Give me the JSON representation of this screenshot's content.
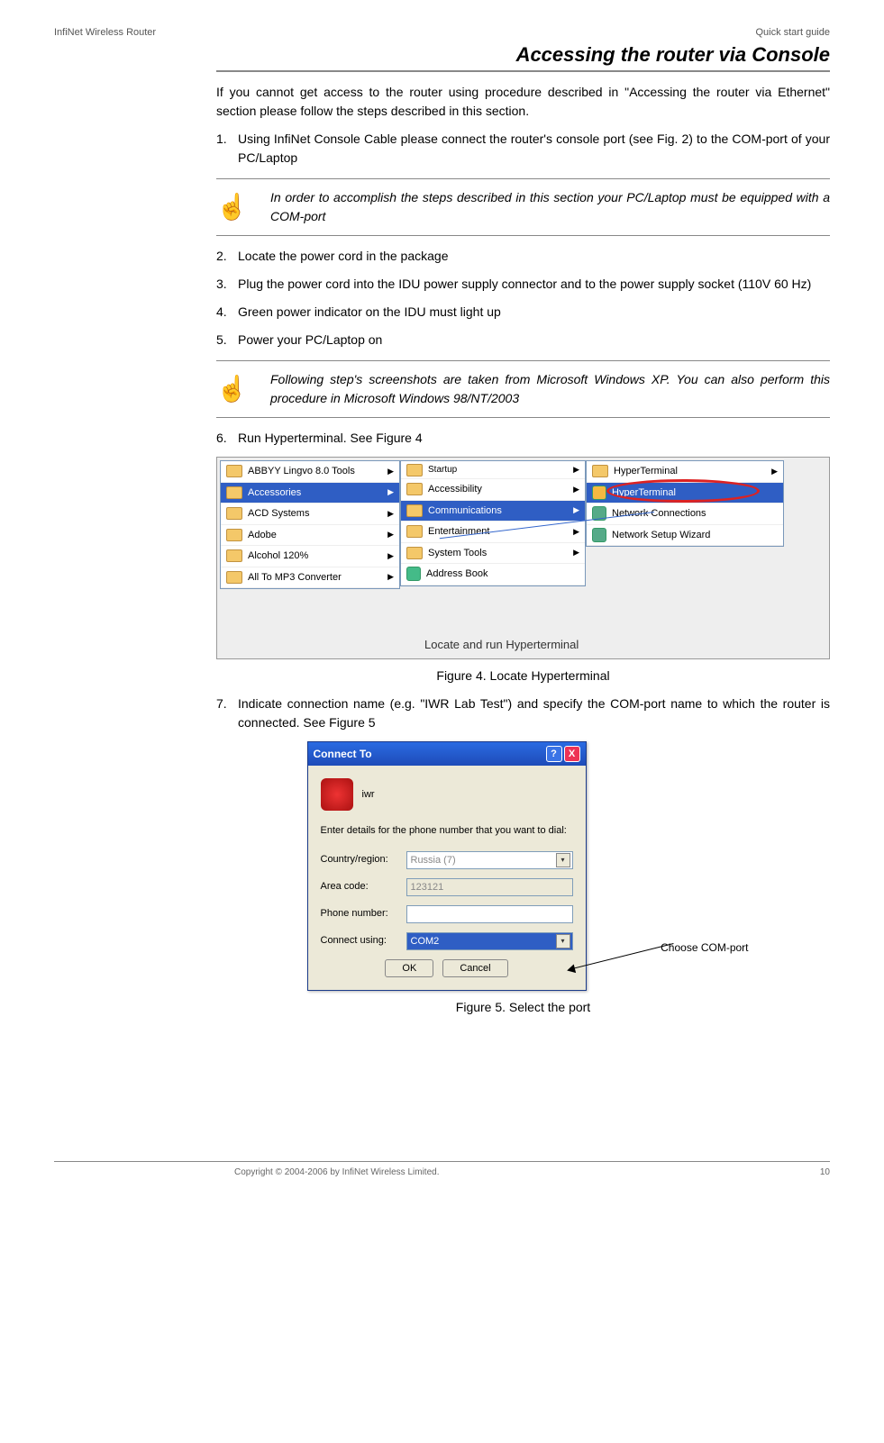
{
  "header": {
    "left": "InfiNet Wireless Router",
    "right": "Quick start guide"
  },
  "title": "Accessing the router via Console",
  "intro": "If you cannot get access to the router using procedure described in \"Accessing the router via Ethernet\" section please follow the steps described in this section.",
  "steps": {
    "s1": {
      "num": "1.",
      "text": "Using InfiNet Console Cable please connect the router's console port (see Fig. 2) to the COM-port of your PC/Laptop"
    },
    "s2": {
      "num": "2.",
      "text": "Locate the power cord in the package"
    },
    "s3": {
      "num": "3.",
      "text": "Plug the power cord into the IDU power supply connector and to the power supply socket (110V 60 Hz)"
    },
    "s4": {
      "num": "4.",
      "text": "Green power indicator on the IDU must light up"
    },
    "s5": {
      "num": "5.",
      "text": "Power your PC/Laptop on"
    },
    "s6": {
      "num": "6.",
      "text": "Run Hyperterminal. See Figure 4"
    },
    "s7": {
      "num": "7.",
      "text": "Indicate connection name (e.g. \"IWR Lab Test\") and specify the COM-port name to which the router is connected. See Figure 5"
    }
  },
  "note1": "In order to accomplish the steps described in this section your PC/Laptop must be equipped with a COM-port",
  "note2": "Following step's screenshots are taken from Microsoft Windows XP. You can also perform this procedure in Microsoft Windows 98/NT/2003",
  "figure4": {
    "caption": "Figure 4. Locate Hyperterminal",
    "col1": [
      "ABBYY Lingvo 8.0 Tools",
      "Accessories",
      "ACD Systems",
      "Adobe",
      "Alcohol 120%",
      "All To MP3 Converter"
    ],
    "col2_top": "Startup",
    "col2": [
      "Accessibility",
      "Communications",
      "Entertainment",
      "System Tools",
      "Address Book"
    ],
    "col3": [
      "HyperTerminal",
      "HyperTerminal",
      "Network Connections",
      "Network Setup Wizard"
    ],
    "locate_label": "Locate and run Hyperterminal"
  },
  "figure5": {
    "caption": "Figure 5. Select the port",
    "dialog_title": "Connect To",
    "conn_name": "iwr",
    "instruction": "Enter details for the phone number that you want to dial:",
    "labels": {
      "country": "Country/region:",
      "area": "Area code:",
      "phone": "Phone number:",
      "connect": "Connect using:"
    },
    "values": {
      "country": "Russia (7)",
      "area": "123121",
      "phone": "",
      "connect": "COM2"
    },
    "btn_ok": "OK",
    "btn_cancel": "Cancel",
    "choose_label": "Choose COM-port"
  },
  "footer": {
    "copyright": "Copyright © 2004-2006 by InfiNet Wireless Limited.",
    "page": "10"
  }
}
